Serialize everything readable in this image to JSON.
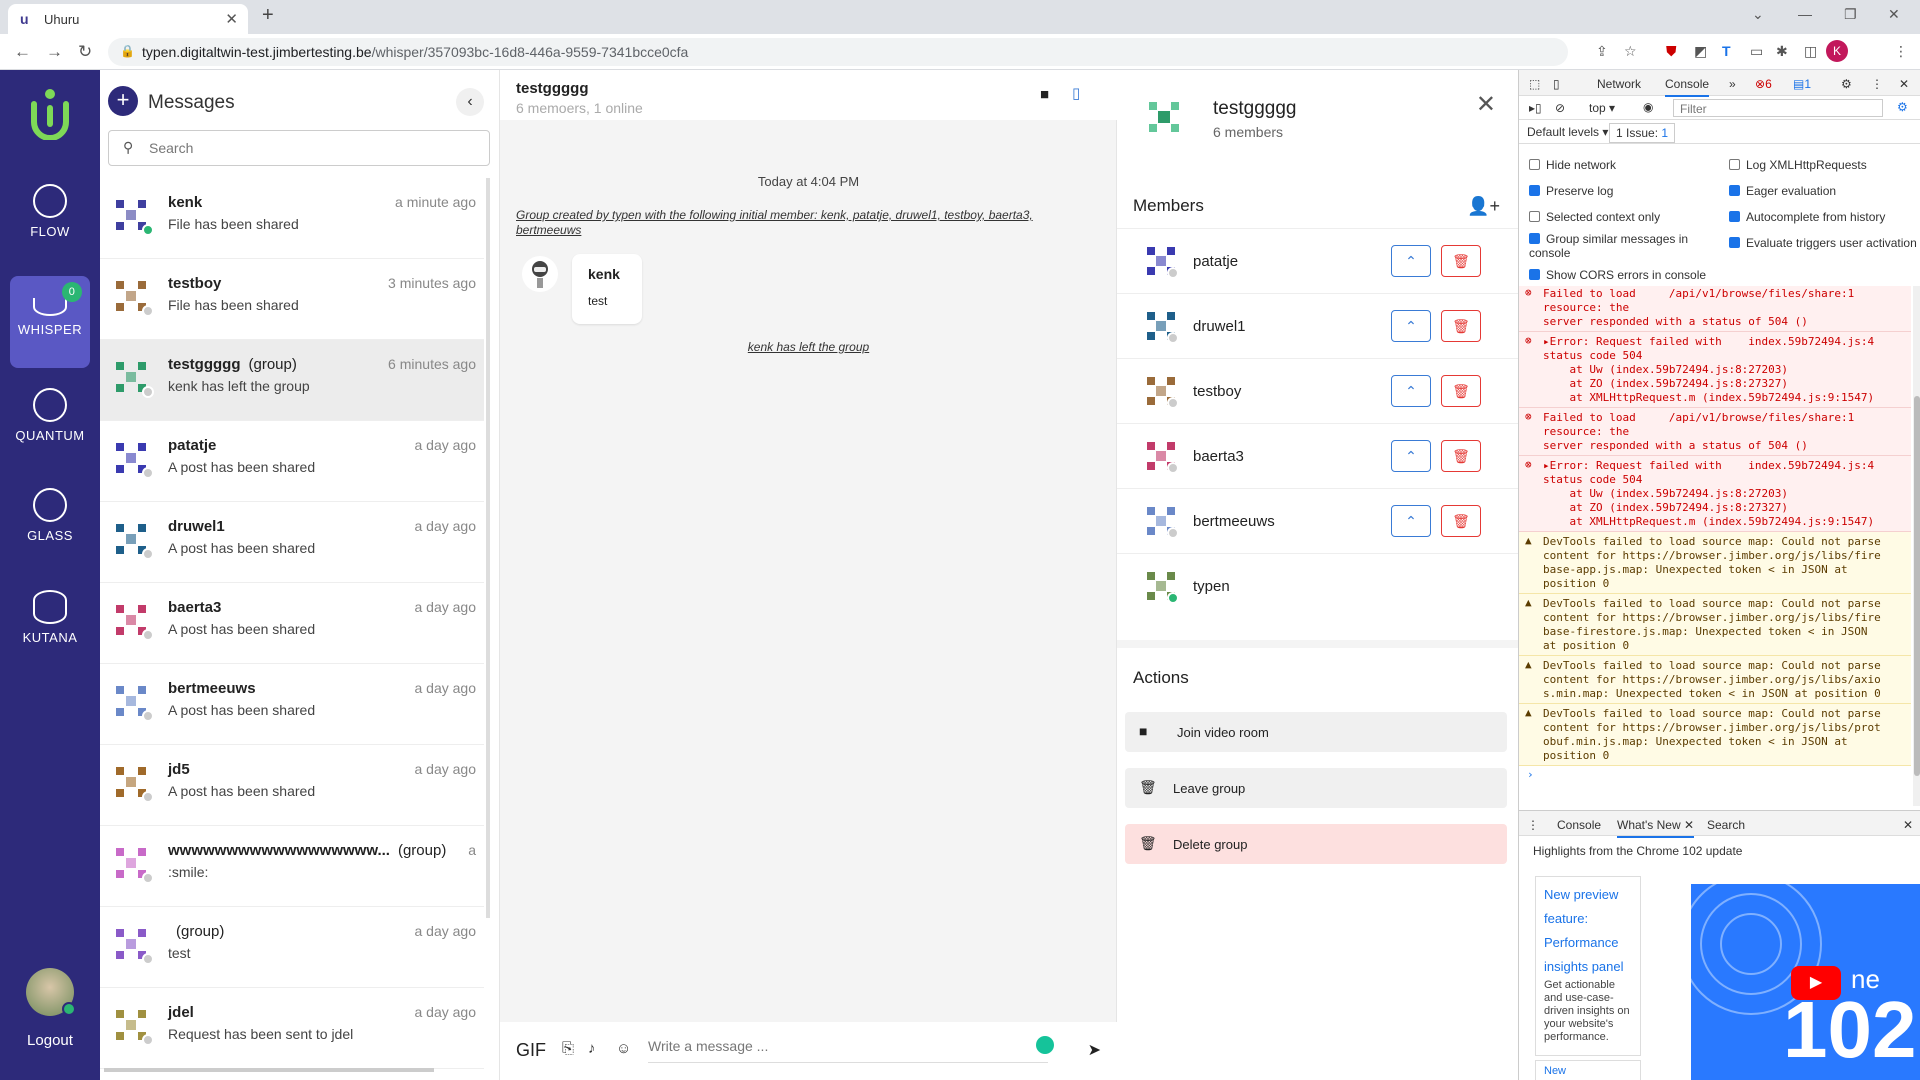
{
  "browser": {
    "tab_title": "Uhuru",
    "url_host": "typen.digitaltwin-test.jimbertesting.be",
    "url_path": "/whisper/357093bc-16d8-446a-9559-7341bcce0cfa"
  },
  "rail": {
    "items": [
      {
        "label": "FLOW"
      },
      {
        "label": "WHISPER",
        "badge": "0"
      },
      {
        "label": "QUANTUM"
      },
      {
        "label": "GLASS"
      },
      {
        "label": "KUTANA"
      }
    ],
    "logout": "Logout"
  },
  "messages": {
    "title": "Messages",
    "search_placeholder": "Search",
    "conversations": [
      {
        "name": "kenk",
        "tag": "",
        "preview": "File has been shared",
        "time": "a minute ago",
        "online": true
      },
      {
        "name": "testboy",
        "tag": "",
        "preview": "File has been shared",
        "time": "3 minutes ago",
        "online": false
      },
      {
        "name": "testggggg",
        "tag": "(group)",
        "preview": "kenk has left the group",
        "time": "6 minutes ago",
        "online": false
      },
      {
        "name": "patatje",
        "tag": "",
        "preview": "A post has been shared",
        "time": "a day ago",
        "online": false
      },
      {
        "name": "druwel1",
        "tag": "",
        "preview": "A post has been shared",
        "time": "a day ago",
        "online": false
      },
      {
        "name": "baerta3",
        "tag": "",
        "preview": "A post has been shared",
        "time": "a day ago",
        "online": false
      },
      {
        "name": "bertmeeuws",
        "tag": "",
        "preview": "A post has been shared",
        "time": "a day ago",
        "online": false
      },
      {
        "name": "jd5",
        "tag": "",
        "preview": "A post has been shared",
        "time": "a day ago",
        "online": false
      },
      {
        "name": "wwwwwwwwwwwwwwwwww...",
        "tag": "(group)",
        "preview": ":smile:",
        "time": "a",
        "online": false
      },
      {
        "name": "",
        "tag": "(group)",
        "preview": "test",
        "time": "a day ago",
        "online": false
      },
      {
        "name": "jdel",
        "tag": "",
        "preview": "Request has been sent to jdel",
        "time": "a day ago",
        "online": false
      }
    ]
  },
  "chat": {
    "name": "testggggg",
    "subtitle": "6 memoers, 1 online",
    "day": "Today at 4:04 PM",
    "system_message": "Group created by typen with the following initial member: kenk, patatje, druwel1, testboy, baerta3, bertmeeuws",
    "bubble_sender": "kenk",
    "bubble_text": "test",
    "left_message": "kenk has left the group",
    "composer_gif": "GIF",
    "composer_placeholder": "Write a message ..."
  },
  "info": {
    "group_name": "testggggg",
    "members_count": "6 members",
    "members_heading": "Members",
    "members": [
      {
        "name": "patatje",
        "admin_actions": true,
        "online": false
      },
      {
        "name": "druwel1",
        "admin_actions": true,
        "online": false
      },
      {
        "name": "testboy",
        "admin_actions": true,
        "online": false
      },
      {
        "name": "baerta3",
        "admin_actions": true,
        "online": false
      },
      {
        "name": "bertmeeuws",
        "admin_actions": true,
        "online": false
      },
      {
        "name": "typen",
        "admin_actions": false,
        "online": true
      }
    ],
    "actions_heading": "Actions",
    "actions": [
      {
        "label": "Join video room"
      },
      {
        "label": "Leave group"
      },
      {
        "label": "Delete group"
      }
    ]
  },
  "devtools": {
    "tabs": [
      "Network",
      "Console"
    ],
    "error_count": "6",
    "message_count": "1",
    "context": "top",
    "filter_placeholder": "Filter",
    "levels": "Default levels",
    "issues": "1 Issue:",
    "issues_count": "1",
    "settings": [
      {
        "label": "Hide network",
        "checked": false
      },
      {
        "label": "Log XMLHttpRequests",
        "checked": false
      },
      {
        "label": "Preserve log",
        "checked": true
      },
      {
        "label": "Eager evaluation",
        "checked": true
      },
      {
        "label": "Selected context only",
        "checked": false
      },
      {
        "label": "Autocomplete from history",
        "checked": true
      },
      {
        "label": "Group similar messages in console",
        "checked": true
      },
      {
        "label": "Evaluate triggers user activation",
        "checked": true
      },
      {
        "label": "Show CORS errors in console",
        "checked": true
      }
    ],
    "logs": [
      {
        "kind": "err",
        "text": "Failed to load     /api/v1/browse/files/share:1\nresource: the\nserver responded with a status of 504 ()"
      },
      {
        "kind": "err",
        "text": "▸Error: Request failed with    index.59b72494.js:4\nstatus code 504\n    at Uw (index.59b72494.js:8:27203)\n    at ZO (index.59b72494.js:8:27327)\n    at XMLHttpRequest.m (index.59b72494.js:9:1547)"
      },
      {
        "kind": "err",
        "text": "Failed to load     /api/v1/browse/files/share:1\nresource: the\nserver responded with a status of 504 ()"
      },
      {
        "kind": "err",
        "text": "▸Error: Request failed with    index.59b72494.js:4\nstatus code 504\n    at Uw (index.59b72494.js:8:27203)\n    at ZO (index.59b72494.js:8:27327)\n    at XMLHttpRequest.m (index.59b72494.js:9:1547)"
      },
      {
        "kind": "warn",
        "text": "DevTools failed to load source map: Could not parse\ncontent for https://browser.jimber.org/js/libs/fire\nbase-app.js.map: Unexpected token < in JSON at\nposition 0"
      },
      {
        "kind": "warn",
        "text": "DevTools failed to load source map: Could not parse\ncontent for https://browser.jimber.org/js/libs/fire\nbase-firestore.js.map: Unexpected token < in JSON\nat position 0"
      },
      {
        "kind": "warn",
        "text": "DevTools failed to load source map: Could not parse\ncontent for https://browser.jimber.org/js/libs/axio\ns.min.map: Unexpected token < in JSON at position 0"
      },
      {
        "kind": "warn",
        "text": "DevTools failed to load source map: Could not parse\ncontent for https://browser.jimber.org/js/libs/prot\nobuf.min.js.map: Unexpected token < in JSON at\nposition 0"
      }
    ],
    "drawer_tabs": [
      "Console",
      "What's New",
      "Search"
    ],
    "drawer_heading": "Highlights from the Chrome 102 update",
    "card_title": "New preview feature: Performance insights panel",
    "card_body": "Get actionable and use-case-driven insights on your website's performance.",
    "card_more": "New",
    "promo_text": "102",
    "promo_ne": "ne"
  },
  "colors": {
    "rail": "#2d2a7a",
    "whisper_active": "#5a58c4",
    "online": "#2bb673",
    "danger": "#e53935",
    "primary": "#3a7bd5"
  }
}
